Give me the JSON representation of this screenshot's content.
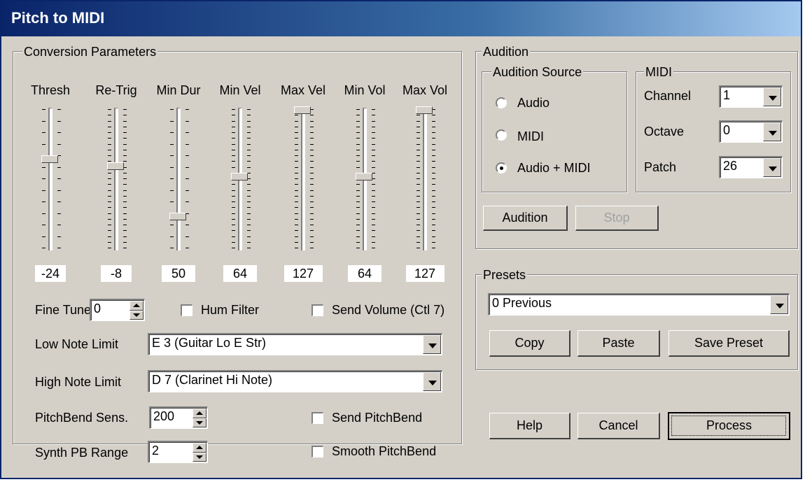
{
  "window": {
    "title": "Pitch to MIDI"
  },
  "conversion": {
    "legend": "Conversion Parameters",
    "sliders": [
      {
        "label": "Thresh",
        "value": "-24",
        "level": 0.37
      },
      {
        "label": "Re-Trig",
        "value": "-8",
        "level": 0.42
      },
      {
        "label": "Min Dur",
        "value": "50",
        "level": 0.8
      },
      {
        "label": "Min Vel",
        "value": "64",
        "level": 0.5
      },
      {
        "label": "Max Vel",
        "value": "127",
        "level": 0.0
      },
      {
        "label": "Min Vol",
        "value": "64",
        "level": 0.5
      },
      {
        "label": "Max Vol",
        "value": "127",
        "level": 0.0
      }
    ],
    "fine_tune": {
      "label": "Fine Tune",
      "value": "0"
    },
    "hum_filter": {
      "label": "Hum Filter",
      "checked": false
    },
    "send_volume": {
      "label": "Send Volume (Ctl 7)",
      "checked": false
    },
    "low_note": {
      "label": "Low Note Limit",
      "value": "E  3 (Guitar Lo E Str)"
    },
    "high_note": {
      "label": "High Note Limit",
      "value": "D  7 (Clarinet Hi Note)"
    },
    "pb_sens": {
      "label": "PitchBend Sens.",
      "value": "200"
    },
    "synth_pb": {
      "label": "Synth PB Range",
      "value": "2"
    },
    "send_pb": {
      "label": "Send PitchBend",
      "checked": false
    },
    "smooth_pb": {
      "label": "Smooth PitchBend",
      "checked": false
    }
  },
  "audition": {
    "legend": "Audition",
    "source": {
      "legend": "Audition Source",
      "options": [
        {
          "label": "Audio",
          "selected": false
        },
        {
          "label": "MIDI",
          "selected": false
        },
        {
          "label": "Audio + MIDI",
          "selected": true
        }
      ]
    },
    "midi": {
      "legend": "MIDI",
      "channel": {
        "label": "Channel",
        "value": "1"
      },
      "octave": {
        "label": "Octave",
        "value": "0"
      },
      "patch": {
        "label": "Patch",
        "value": "26"
      }
    },
    "audition_button": "Audition",
    "stop_button": "Stop"
  },
  "presets": {
    "legend": "Presets",
    "selected": "0 Previous",
    "copy_button": "Copy",
    "paste_button": "Paste",
    "save_button": "Save Preset"
  },
  "footer": {
    "help": "Help",
    "cancel": "Cancel",
    "process": "Process"
  }
}
